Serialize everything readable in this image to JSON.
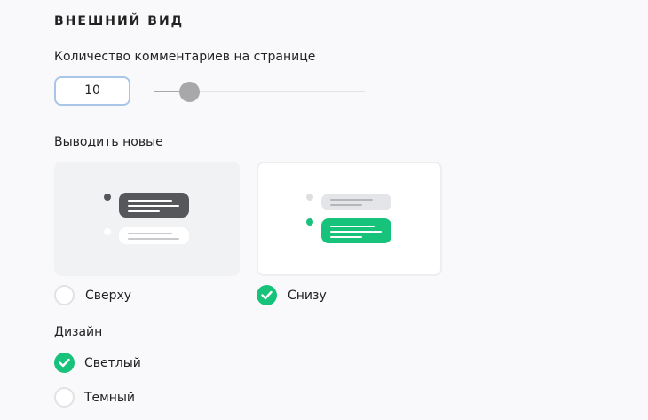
{
  "section": {
    "title": "ВНЕШНИЙ ВИД"
  },
  "comments_per_page": {
    "label": "Количество комментариев на странице",
    "value": "10",
    "slider_level_percent": 17
  },
  "order": {
    "label": "Выводить новые",
    "options": [
      {
        "label": "Сверху",
        "selected": false
      },
      {
        "label": "Снизу",
        "selected": true
      }
    ]
  },
  "design": {
    "label": "Дизайн",
    "options": [
      {
        "label": "Светлый",
        "selected": true
      },
      {
        "label": "Темный",
        "selected": false
      }
    ]
  },
  "colors": {
    "accent_green": "#17c27a",
    "dark_bubble": "#55575b",
    "input_border": "#a9c6e8"
  },
  "icons": {
    "selected": "check-icon",
    "slider": "slider-knob"
  }
}
